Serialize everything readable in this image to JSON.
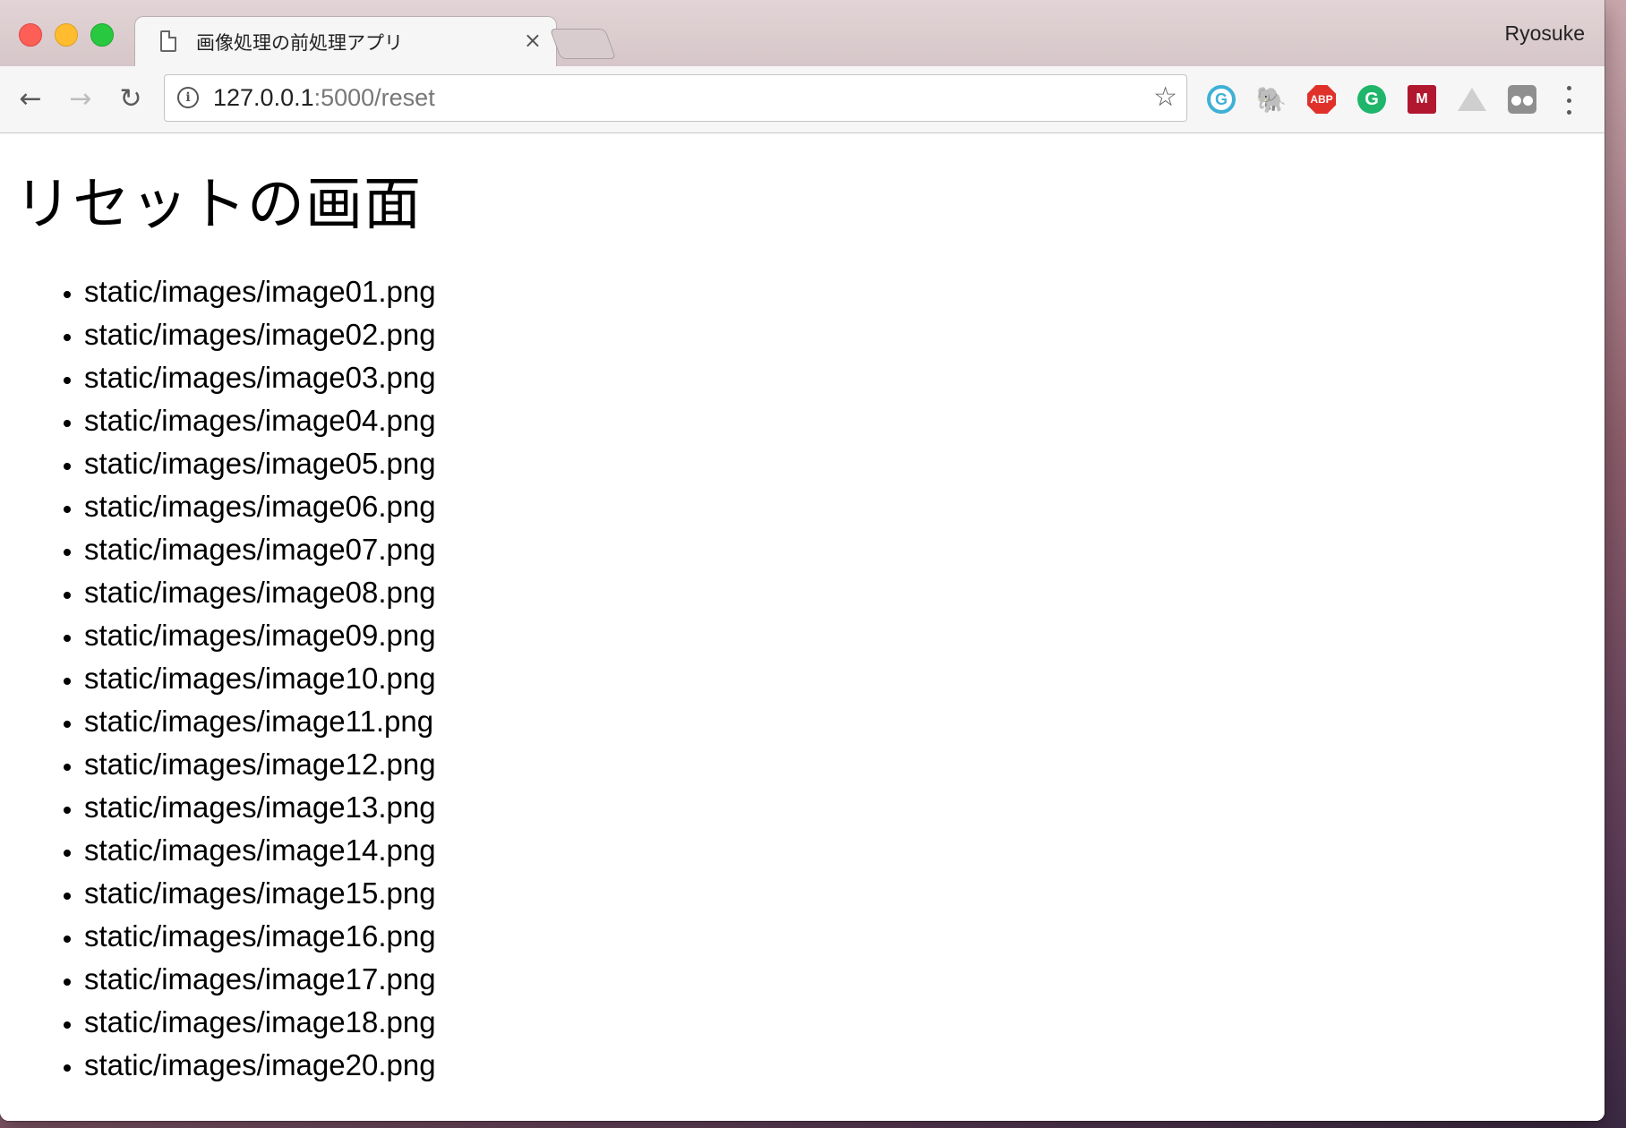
{
  "browser": {
    "tab_title": "画像処理の前処理アプリ",
    "tab_close": "×",
    "profile_name": "Ryosuke",
    "url_host": "127.0.0.1",
    "url_rest": ":5000/reset",
    "nav": {
      "back": "←",
      "forward": "→",
      "reload": "↻"
    },
    "bookmark_star": "☆",
    "extensions": [
      {
        "name": "grammarly-icon",
        "glyph": "G"
      },
      {
        "name": "evernote-icon",
        "glyph": "🐘"
      },
      {
        "name": "adblock-plus-icon",
        "glyph": "ABP"
      },
      {
        "name": "grammarly-green-icon",
        "glyph": "G"
      },
      {
        "name": "mendeley-icon",
        "glyph": "M"
      },
      {
        "name": "google-drive-icon",
        "glyph": ""
      },
      {
        "name": "incognito-glasses-icon",
        "glyph": ""
      }
    ]
  },
  "page": {
    "heading": "リセットの画面",
    "images": [
      "static/images/image01.png",
      "static/images/image02.png",
      "static/images/image03.png",
      "static/images/image04.png",
      "static/images/image05.png",
      "static/images/image06.png",
      "static/images/image07.png",
      "static/images/image08.png",
      "static/images/image09.png",
      "static/images/image10.png",
      "static/images/image11.png",
      "static/images/image12.png",
      "static/images/image13.png",
      "static/images/image14.png",
      "static/images/image15.png",
      "static/images/image16.png",
      "static/images/image17.png",
      "static/images/image18.png",
      "static/images/image20.png"
    ]
  }
}
